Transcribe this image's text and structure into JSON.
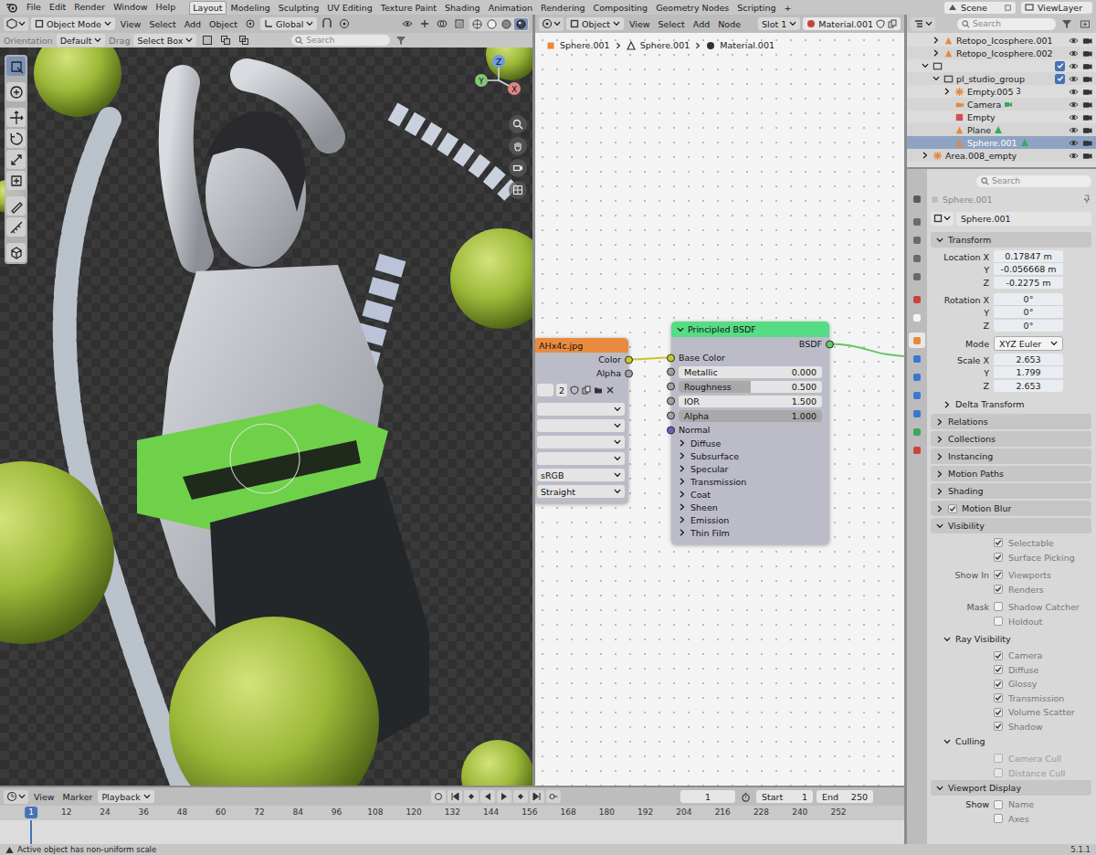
{
  "topbar": {
    "menus": [
      "File",
      "Edit",
      "Render",
      "Window",
      "Help"
    ],
    "workspaces": [
      {
        "label": "Layout",
        "selected": true
      },
      {
        "label": "Modeling",
        "selected": false
      },
      {
        "label": "Sculpting",
        "selected": false
      },
      {
        "label": "UV Editing",
        "selected": false
      },
      {
        "label": "Texture Paint",
        "selected": false
      },
      {
        "label": "Shading",
        "selected": false
      },
      {
        "label": "Animation",
        "selected": false
      },
      {
        "label": "Rendering",
        "selected": false
      },
      {
        "label": "Compositing",
        "selected": false
      },
      {
        "label": "Geometry Nodes",
        "selected": false
      },
      {
        "label": "Scripting",
        "selected": false
      }
    ],
    "add_workspace": "+",
    "scene": "Scene",
    "view_layer": "ViewLayer"
  },
  "viewport": {
    "mode": "Object Mode",
    "menus": [
      "View",
      "Select",
      "Add",
      "Object"
    ],
    "transform_orientation": "Global",
    "orientation_label": "Orientation",
    "orientation": "Default",
    "drag_label": "Drag",
    "drag": "Select Box",
    "search_placeholder": "Search",
    "tools": [
      {
        "selected": true
      },
      {
        "selected": false
      },
      {
        "selected": false
      },
      {
        "selected": false
      },
      {
        "selected": false
      },
      {
        "selected": false
      },
      {
        "selected": false
      },
      {
        "selected": false
      },
      {
        "selected": false
      }
    ],
    "gizmo": [
      {
        "label": "Z",
        "color": "#6e9be0"
      },
      {
        "label": "Y",
        "color": "#86c477"
      },
      {
        "label": "X",
        "color": "#e08585"
      }
    ]
  },
  "node_editor": {
    "object_type": "Object",
    "menus": [
      "View",
      "Select",
      "Add",
      "Node"
    ],
    "slot": "Slot 1",
    "material": "Material.001",
    "breadcrumbs": [
      "Sphere.001",
      "Sphere.001",
      "Material.001"
    ],
    "image_node": {
      "title": "AHx4c.jpg",
      "outputs": [
        {
          "label": "Color",
          "color": "#c7c729"
        },
        {
          "label": "Alpha",
          "color": "#a1a1a1"
        }
      ],
      "users": "2",
      "fields": [
        "",
        "",
        "",
        "",
        "sRGB",
        "Straight"
      ]
    },
    "principled": {
      "title": "Principled BSDF",
      "expanded": true,
      "output": {
        "label": "BSDF",
        "color": "#63c763"
      },
      "inputs": [
        {
          "label": "Base Color",
          "kind": "socket",
          "color": "#c7c729"
        },
        {
          "label": "Metallic",
          "kind": "slider",
          "value": "0.000",
          "level": 0,
          "color": "#a1a1a1"
        },
        {
          "label": "Roughness",
          "kind": "slider",
          "value": "0.500",
          "level": 0.5,
          "color": "#a1a1a1"
        },
        {
          "label": "IOR",
          "kind": "slider",
          "value": "1.500",
          "level": 0,
          "color": "#a1a1a1"
        },
        {
          "label": "Alpha",
          "kind": "slider",
          "value": "1.000",
          "level": 1,
          "color": "#a1a1a1"
        },
        {
          "label": "Normal",
          "kind": "socket",
          "color": "#6363c7"
        }
      ],
      "sections": [
        {
          "label": "Diffuse",
          "expanded": false
        },
        {
          "label": "Subsurface",
          "expanded": false
        },
        {
          "label": "Specular",
          "expanded": false
        },
        {
          "label": "Transmission",
          "expanded": false
        },
        {
          "label": "Coat",
          "expanded": false
        },
        {
          "label": "Sheen",
          "expanded": false
        },
        {
          "label": "Emission",
          "expanded": false
        },
        {
          "label": "Thin Film",
          "expanded": false
        }
      ]
    }
  },
  "outliner": {
    "search_placeholder": "Search",
    "rows": [
      {
        "label": "Retopo_Icosphere.001",
        "kind": "mesh",
        "depth": 2,
        "has_children": true,
        "expanded": false,
        "selected": false,
        "checkbox": false,
        "checked": false,
        "visible": true,
        "renderable": true
      },
      {
        "label": "Retopo_Icosphere.002",
        "kind": "mesh",
        "depth": 2,
        "has_children": true,
        "expanded": false,
        "selected": false,
        "checkbox": false,
        "checked": false,
        "visible": true,
        "renderable": true
      },
      {
        "label": "",
        "kind": "collection",
        "depth": 1,
        "has_children": true,
        "expanded": true,
        "selected": false,
        "checkbox": true,
        "checked": true,
        "visible": true,
        "renderable": true
      },
      {
        "label": "pl_studio_group",
        "kind": "collection",
        "depth": 2,
        "has_children": true,
        "expanded": true,
        "selected": false,
        "checkbox": true,
        "checked": true,
        "visible": true,
        "renderable": true
      },
      {
        "label": "Empty.005",
        "kind": "empty",
        "depth": 3,
        "has_children": true,
        "expanded": false,
        "selected": false,
        "checkbox": false,
        "checked": false,
        "visible": true,
        "renderable": true,
        "child_count": "3"
      },
      {
        "label": "Camera",
        "kind": "camera",
        "depth": 3,
        "has_children": false,
        "expanded": false,
        "selected": false,
        "checkbox": false,
        "checked": false,
        "visible": true,
        "renderable": true
      },
      {
        "label": "Empty",
        "kind": "image_empty",
        "depth": 3,
        "has_children": false,
        "expanded": false,
        "selected": false,
        "checkbox": false,
        "checked": false,
        "visible": true,
        "renderable": true
      },
      {
        "label": "Plane",
        "kind": "mesh",
        "depth": 3,
        "has_children": false,
        "expanded": false,
        "selected": false,
        "checkbox": false,
        "checked": false,
        "visible": true,
        "renderable": true
      },
      {
        "label": "Sphere.001",
        "kind": "mesh",
        "depth": 3,
        "has_children": false,
        "expanded": false,
        "selected": true,
        "checkbox": false,
        "checked": false,
        "visible": true,
        "renderable": true
      },
      {
        "label": "Area.008_empty",
        "kind": "empty",
        "depth": 1,
        "has_children": true,
        "expanded": false,
        "selected": false,
        "checkbox": false,
        "checked": false,
        "visible": true,
        "renderable": true
      }
    ]
  },
  "properties": {
    "search_placeholder": "Search",
    "tabs": [
      {
        "selected": false
      },
      {
        "selected": false
      },
      {
        "selected": false
      },
      {
        "selected": false
      },
      {
        "selected": false
      },
      {
        "selected": false
      },
      {
        "selected": false
      },
      {
        "selected": true
      },
      {
        "selected": false
      },
      {
        "selected": false
      },
      {
        "selected": false
      },
      {
        "selected": false
      },
      {
        "selected": false
      },
      {
        "selected": false
      }
    ],
    "context_path": "Sphere.001",
    "object_name": "Sphere.001",
    "transform": {
      "title": "Transform",
      "expanded": true,
      "location_label": "Location",
      "location": [
        {
          "axis": "X",
          "value": "0.17847 m"
        },
        {
          "axis": "Y",
          "value": "-0.056668 m"
        },
        {
          "axis": "Z",
          "value": "-0.2275 m"
        }
      ],
      "rotation_label": "Rotation",
      "rotation": [
        {
          "axis": "X",
          "value": "0°"
        },
        {
          "axis": "Y",
          "value": "0°"
        },
        {
          "axis": "Z",
          "value": "0°"
        }
      ],
      "mode_label": "Mode",
      "mode": "XYZ Euler",
      "scale_label": "Scale",
      "scale": [
        {
          "axis": "X",
          "value": "2.653"
        },
        {
          "axis": "Y",
          "value": "1.799"
        },
        {
          "axis": "Z",
          "value": "2.653"
        }
      ],
      "delta": {
        "title": "Delta Transform",
        "expanded": false
      }
    },
    "panels": [
      {
        "title": "Relations",
        "expanded": false,
        "checkbox": false,
        "checked": false
      },
      {
        "title": "Collections",
        "expanded": false,
        "checkbox": false,
        "checked": false
      },
      {
        "title": "Instancing",
        "expanded": false,
        "checkbox": false,
        "checked": false
      },
      {
        "title": "Motion Paths",
        "expanded": false,
        "checkbox": false,
        "checked": false
      },
      {
        "title": "Shading",
        "expanded": false,
        "checkbox": false,
        "checked": false
      },
      {
        "title": "Motion Blur",
        "expanded": false,
        "checkbox": true,
        "checked": true
      }
    ],
    "visibility": {
      "title": "Visibility",
      "expanded": true,
      "groups": [
        {
          "label": "",
          "items": [
            {
              "label": "Selectable",
              "checked": true
            },
            {
              "label": "Surface Picking",
              "checked": true
            }
          ]
        },
        {
          "label": "Show In",
          "items": [
            {
              "label": "Viewports",
              "checked": true
            },
            {
              "label": "Renders",
              "checked": true
            }
          ]
        },
        {
          "label": "Mask",
          "items": [
            {
              "label": "Shadow Catcher",
              "checked": false
            },
            {
              "label": "Holdout",
              "checked": false
            }
          ]
        }
      ],
      "ray_visibility": {
        "title": "Ray Visibility",
        "expanded": true,
        "items": [
          {
            "label": "Camera",
            "checked": true,
            "disabled": false
          },
          {
            "label": "Diffuse",
            "checked": true,
            "disabled": false
          },
          {
            "label": "Glossy",
            "checked": true,
            "disabled": false
          },
          {
            "label": "Transmission",
            "checked": true,
            "disabled": false
          },
          {
            "label": "Volume Scatter",
            "checked": true,
            "disabled": false
          },
          {
            "label": "Shadow",
            "checked": true,
            "disabled": false
          }
        ]
      },
      "culling": {
        "title": "Culling",
        "expanded": true,
        "items": [
          {
            "label": "Camera Cull",
            "checked": false,
            "disabled": true
          },
          {
            "label": "Distance Cull",
            "checked": false,
            "disabled": true
          }
        ]
      }
    },
    "viewport_display": {
      "title": "Viewport Display",
      "expanded": true,
      "show_label": "Show",
      "items": [
        {
          "label": "Name",
          "checked": false
        },
        {
          "label": "Axes",
          "checked": false
        }
      ]
    }
  },
  "timeline": {
    "menus": [
      "View",
      "Marker",
      "Playback"
    ],
    "current_frame": "1",
    "start_label": "Start",
    "start": "1",
    "end_label": "End",
    "end": "250",
    "playhead": "1",
    "ruler": [
      "12",
      "24",
      "36",
      "48",
      "60",
      "72",
      "84",
      "96",
      "108",
      "120",
      "132",
      "144",
      "156",
      "168",
      "180",
      "192",
      "204",
      "216",
      "228",
      "240",
      "252"
    ]
  },
  "status_bar": {
    "message": "Active object has non-uniform scale",
    "version": "5.1.1"
  }
}
